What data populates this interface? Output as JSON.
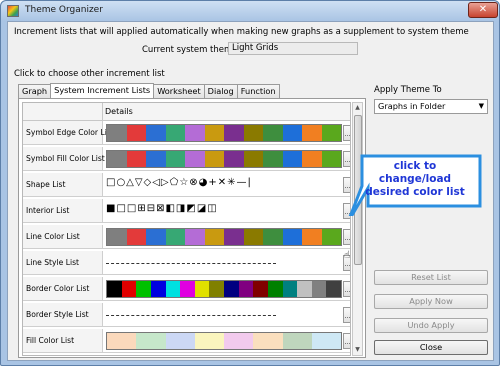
{
  "window": {
    "title": "Theme Organizer",
    "close_glyph": "✕"
  },
  "description": "Increment lists that will applied automatically when making new graphs as a supplement to system theme",
  "current_theme": {
    "label": "Current system theme:",
    "value": "Light Grids"
  },
  "choose_label": "Click to choose other increment list",
  "tabs": [
    "Graph",
    "System Increment Lists",
    "Worksheet",
    "Dialog",
    "Function"
  ],
  "grid": {
    "header": "Details",
    "rows": [
      {
        "name": "Symbol Edge Color List",
        "kind": "colors",
        "colors": [
          "#7f7f7f",
          "#e33a3a",
          "#2b6fd3",
          "#37a874",
          "#b46cd6",
          "#c99a10",
          "#7a2f8f",
          "#8a7a00",
          "#3e8e3e",
          "#1e6fd9",
          "#f17f21",
          "#5aa81d"
        ]
      },
      {
        "name": "Symbol Fill Color List",
        "kind": "colors",
        "colors": [
          "#7f7f7f",
          "#e33a3a",
          "#2b6fd3",
          "#37a874",
          "#b46cd6",
          "#c99a10",
          "#7a2f8f",
          "#8a7a00",
          "#3e8e3e",
          "#1e6fd9",
          "#f17f21",
          "#5aa81d"
        ]
      },
      {
        "name": "Shape List",
        "kind": "glyphs",
        "glyphs": "□○△▽◇◁▷⬠☆⊗◕+✕✳—|"
      },
      {
        "name": "Interior List",
        "kind": "glyphs",
        "glyphs": "■□□⊞⊟⊠◧◨◩◪◫"
      },
      {
        "name": "Line Color List",
        "kind": "colors",
        "colors": [
          "#7f7f7f",
          "#e33a3a",
          "#2b6fd3",
          "#37a874",
          "#b46cd6",
          "#c99a10",
          "#7a2f8f",
          "#8a7a00",
          "#3e8e3e",
          "#1e6fd9",
          "#f17f21",
          "#5aa81d"
        ]
      },
      {
        "name": "Line Style List",
        "kind": "line"
      },
      {
        "name": "Border Color List",
        "kind": "colors",
        "colors": [
          "#000000",
          "#e00000",
          "#00c000",
          "#0000e0",
          "#00e0e0",
          "#e000e0",
          "#e0e000",
          "#808000",
          "#000080",
          "#800080",
          "#800000",
          "#008000",
          "#008080",
          "#c0c0c0",
          "#808080",
          "#404040"
        ]
      },
      {
        "name": "Border Style List",
        "kind": "line"
      },
      {
        "name": "Fill Color List",
        "kind": "soft",
        "colors": [
          "#f6ab6b",
          "#80c98a",
          "#8ea9e8",
          "#f5e86e",
          "#e28ad6",
          "#f4b76f",
          "#70a36c",
          "#92cde8"
        ]
      }
    ],
    "dots_label": "..."
  },
  "apply": {
    "label": "Apply Theme To",
    "selected": "Graphs in Folder"
  },
  "buttons": {
    "reset": "Reset List",
    "apply_now": "Apply Now",
    "undo": "Undo Apply",
    "close": "Close"
  },
  "callout": "click to change/load desired color list",
  "colors": {
    "accent": "#1f36d6",
    "window": "#a9c4e4"
  }
}
